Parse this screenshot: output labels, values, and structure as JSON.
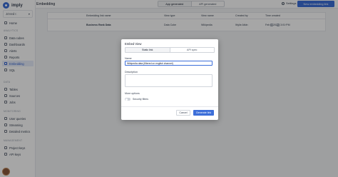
{
  "app": {
    "logo_text": "imply",
    "workspace": "Jo'eed r."
  },
  "sidebar": {
    "home": "Home",
    "analytics_section": "ANALYTICS",
    "analytics": [
      "Data cubes",
      "Dashboards",
      "Alerts",
      "Reports",
      "Embedding",
      "SQL"
    ],
    "data_section": "DATA",
    "data": [
      "Tables",
      "Sources",
      "Jobs"
    ],
    "monitoring_section": "MONITORING",
    "monitoring": [
      "User queries",
      "Streaming",
      "Detailed metrics"
    ],
    "management_section": "MANAGEMENT",
    "management": [
      "Project keys",
      "API keys"
    ]
  },
  "topbar": {
    "title": "Embedding",
    "tabs": [
      "App generated",
      "API generated"
    ],
    "settings_label": "Settings",
    "new_link_label": "New embedding link"
  },
  "table": {
    "headers": [
      "Embedding link name",
      "View type",
      "View name",
      "Created by",
      "Time created"
    ],
    "rows": [
      [
        "Business Rank Data",
        "Data Cube",
        "Wikipedia",
        "Wylie Atkin",
        "Feb 8, 2022, 3:01 PM"
      ]
    ]
  },
  "modal": {
    "title": "Embed View",
    "tabs": [
      "Static link",
      "API spec"
    ],
    "name_label": "Name",
    "name_value": "Wikipedia data (filtered on english channel)",
    "description_label": "Description",
    "more_options": "More options",
    "security_filters": "Security filters",
    "cancel": "Cancel",
    "generate": "Generate link"
  },
  "colors": {
    "accent": "#3d6fd9"
  }
}
